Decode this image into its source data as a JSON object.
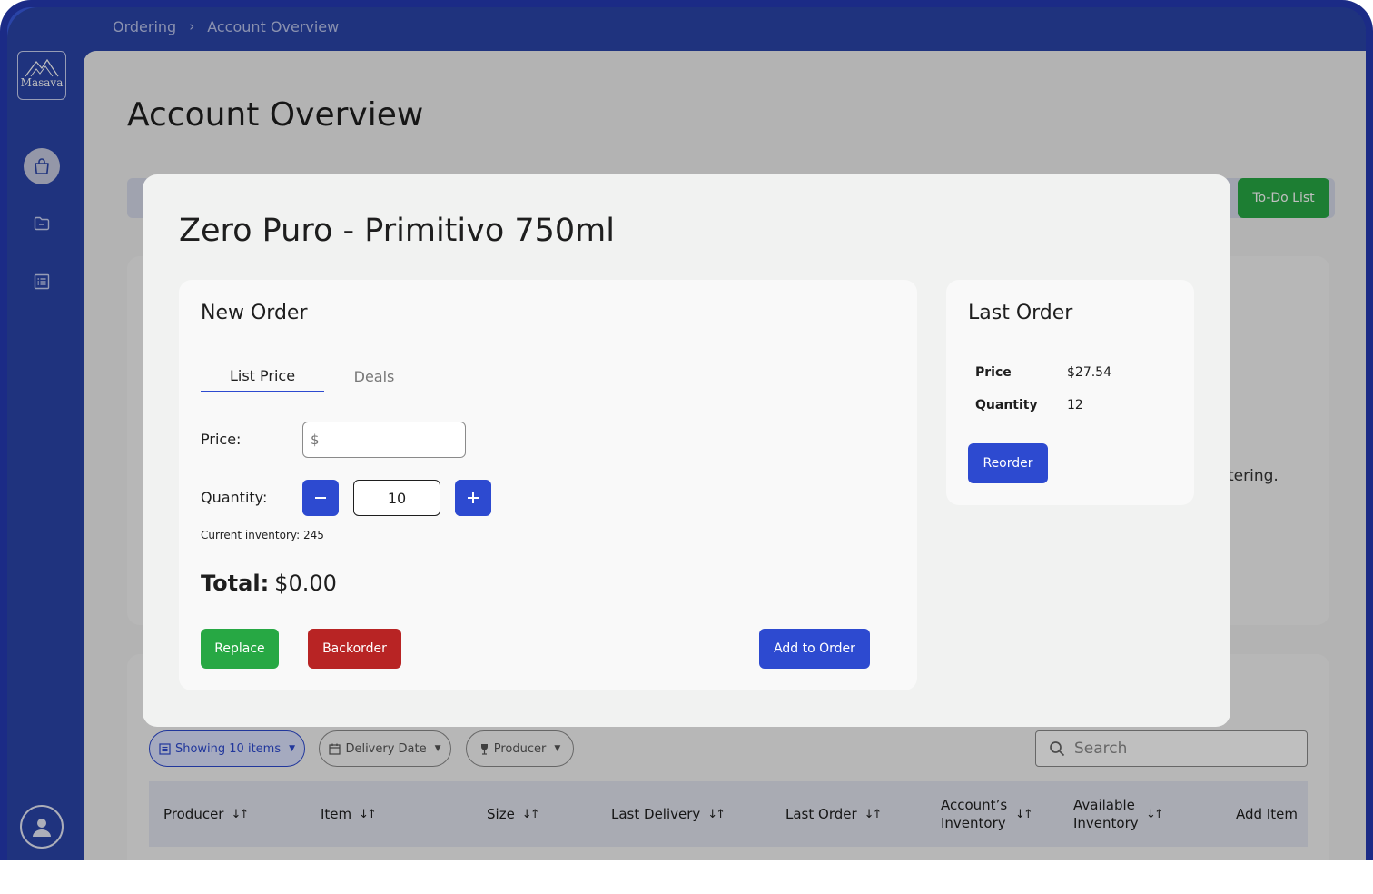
{
  "app": {
    "logo_text": "Masava",
    "breadcrumb": [
      "Ordering",
      "Account Overview"
    ]
  },
  "sidebar": {
    "items": [
      {
        "icon": "shopping-bag-icon",
        "active": true
      },
      {
        "icon": "folder-icon",
        "active": false
      },
      {
        "icon": "list-icon",
        "active": false
      }
    ],
    "profile_icon": "user-icon"
  },
  "page": {
    "title": "Account Overview",
    "todo_label": "To-Do List",
    "background_text": "tering."
  },
  "filters": {
    "showing": "Showing 10 items",
    "delivery_date": "Delivery Date",
    "producer": "Producer",
    "search_placeholder": "Search"
  },
  "table": {
    "columns": [
      "Producer",
      "Item",
      "Size",
      "Last Delivery",
      "Last Order",
      "Account’s Inventory",
      "Available Inventory",
      "Add Item"
    ]
  },
  "modal": {
    "title": "Zero Puro - Primitivo 750ml",
    "new_order": {
      "title": "New Order",
      "tabs": [
        "List Price",
        "Deals"
      ],
      "price_label": "Price:",
      "price_placeholder": "$",
      "quantity_label": "Quantity:",
      "quantity_value": "10",
      "inventory_text": "Current inventory: 245",
      "total_label": "Total:",
      "total_value": "$0.00",
      "replace_label": "Replace",
      "backorder_label": "Backorder",
      "add_label": "Add to Order"
    },
    "last_order": {
      "title": "Last Order",
      "price_label": "Price",
      "price_value": "$27.54",
      "quantity_label": "Quantity",
      "quantity_value": "12",
      "reorder_label": "Reorder"
    }
  },
  "colors": {
    "primary": "#2d4ad0",
    "sidebar": "#2a44a8",
    "success": "#27a844",
    "danger": "#b82424"
  }
}
